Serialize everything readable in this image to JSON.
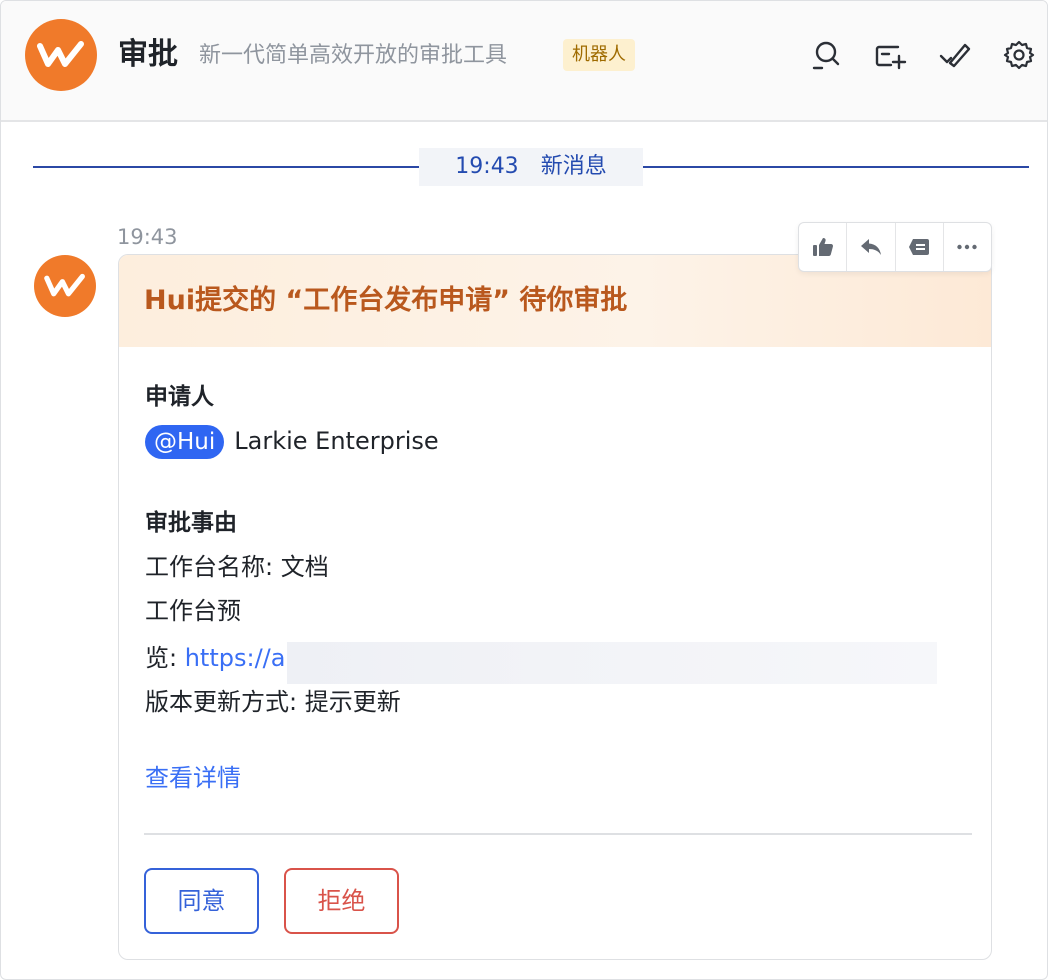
{
  "header": {
    "app_name": "审批",
    "description": "新一代简单高效开放的审批工具",
    "bot_badge": "机器人",
    "icons": [
      "search-icon",
      "add-card-icon",
      "check-edit-icon",
      "gear-icon"
    ]
  },
  "new_message_divider": {
    "time": "19:43",
    "label": "新消息"
  },
  "message": {
    "time": "19:43",
    "card": {
      "title": "Hui提交的 “工作台发布申请” 待你审批",
      "applicant_label": "申请人",
      "applicant_mention": "@Hui",
      "applicant_org": "Larkie Enterprise",
      "reason_label": "审批事由",
      "reason_lines": {
        "name": "工作台名称: 文档",
        "preview_1": "工作台预",
        "preview_2_prefix": "览: ",
        "preview_url": "https://a",
        "update_mode": "版本更新方式: 提示更新"
      },
      "detail_link": "查看详情",
      "approve_button": "同意",
      "reject_button": "拒绝"
    },
    "toolbar_icons": [
      "thumbs-up-icon",
      "reply-icon",
      "quote-icon",
      "more-icon"
    ]
  },
  "colors": {
    "logo_orange": "#f07a2a",
    "divider_blue": "#2b48a5",
    "card_title": "#b9581d",
    "link_blue": "#3a6ff5",
    "approve_blue": "#3562d9",
    "reject_red": "#d9534a"
  }
}
